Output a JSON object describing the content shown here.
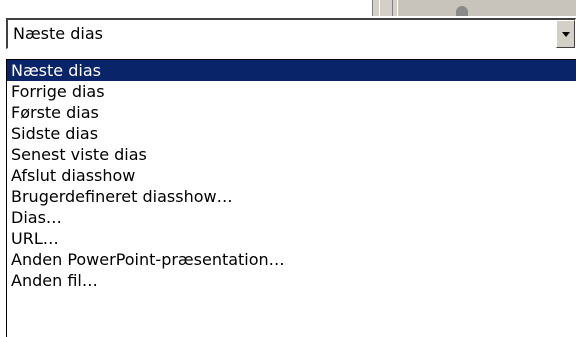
{
  "combo": {
    "selected_value": "Næste dias",
    "dropdown_icon": "chevron-down-icon"
  },
  "dropdown": {
    "options": [
      "Næste dias",
      "Forrige dias",
      "Første dias",
      "Sidste dias",
      "Senest viste dias",
      "Afslut diasshow",
      "Brugerdefineret diasshow…",
      "Dias…",
      "URL…",
      "Anden PowerPoint-præsentation…",
      "Anden fil…"
    ],
    "selected_index": 0
  },
  "colors": {
    "selection_bg": "#0a246a",
    "selection_fg": "#ffffff",
    "face": "#d4d0c8"
  }
}
